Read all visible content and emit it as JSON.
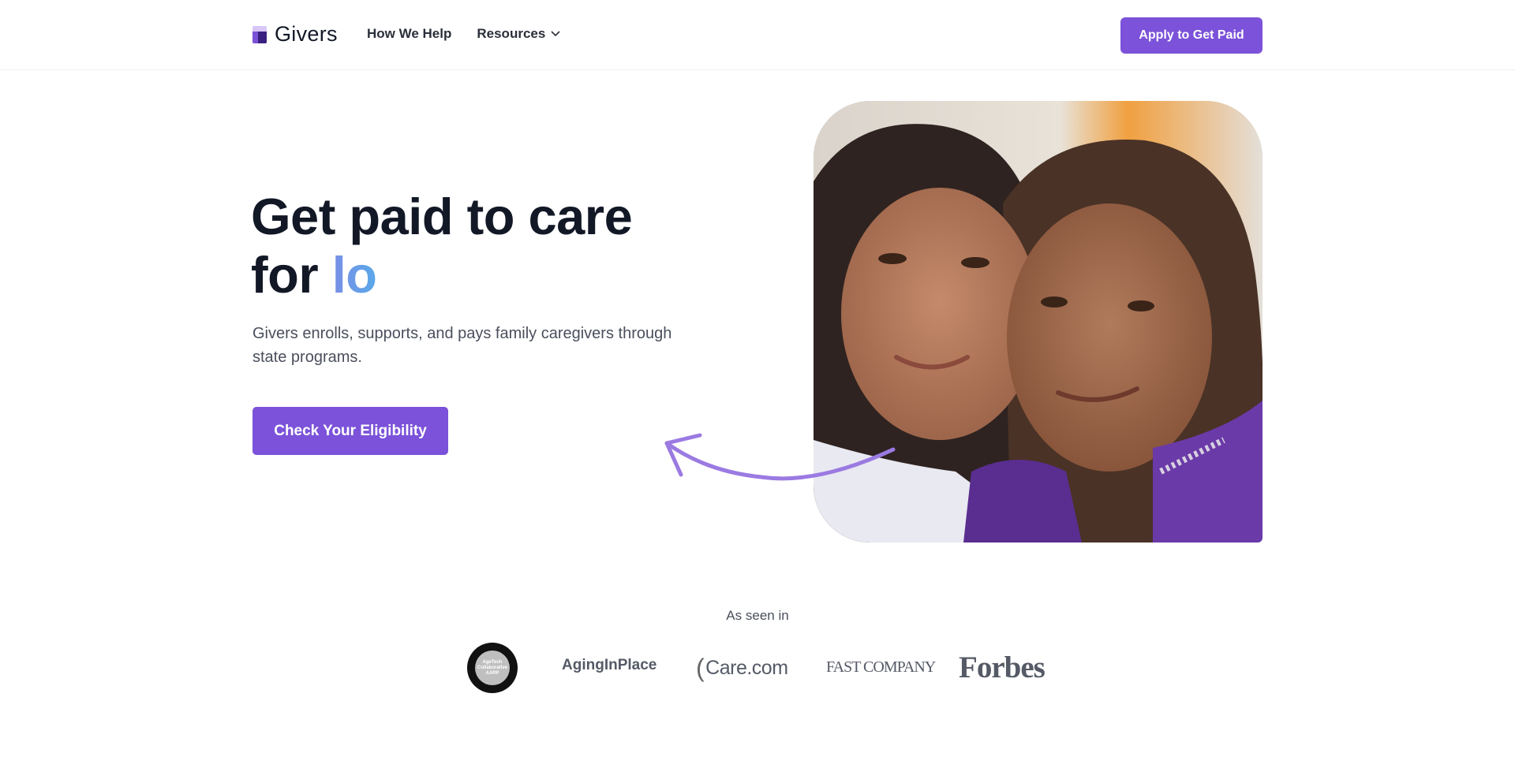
{
  "header": {
    "logo_text": "Givers",
    "nav": [
      {
        "label": "How We Help"
      },
      {
        "label": "Resources"
      }
    ],
    "apply_label": "Apply to Get Paid"
  },
  "hero": {
    "title_line1": "Get paid to care",
    "title_line2_prefix": "for ",
    "title_line2_accent": "lo",
    "subtitle": "Givers enrolls, supports, and pays family caregivers through state programs.",
    "cta_label": "Check Your Eligibility"
  },
  "press": {
    "label": "As seen in",
    "logos": {
      "aarp_line1": "AgeTech",
      "aarp_line2": "Collaborative",
      "aarp_line3": "AARP",
      "aging": "AgingInPlace",
      "carecom": "Care.com",
      "fastco": "FAST COMPANY",
      "forbes": "Forbes"
    }
  },
  "icons": {
    "chevron": "chevron-down-icon",
    "arrow": "curved-arrow-icon"
  },
  "colors": {
    "brand_purple": "#7b52d9",
    "accent_gradient_start": "#7a8fe6",
    "accent_gradient_end": "#5aa8ea",
    "text_dark": "#121826"
  }
}
